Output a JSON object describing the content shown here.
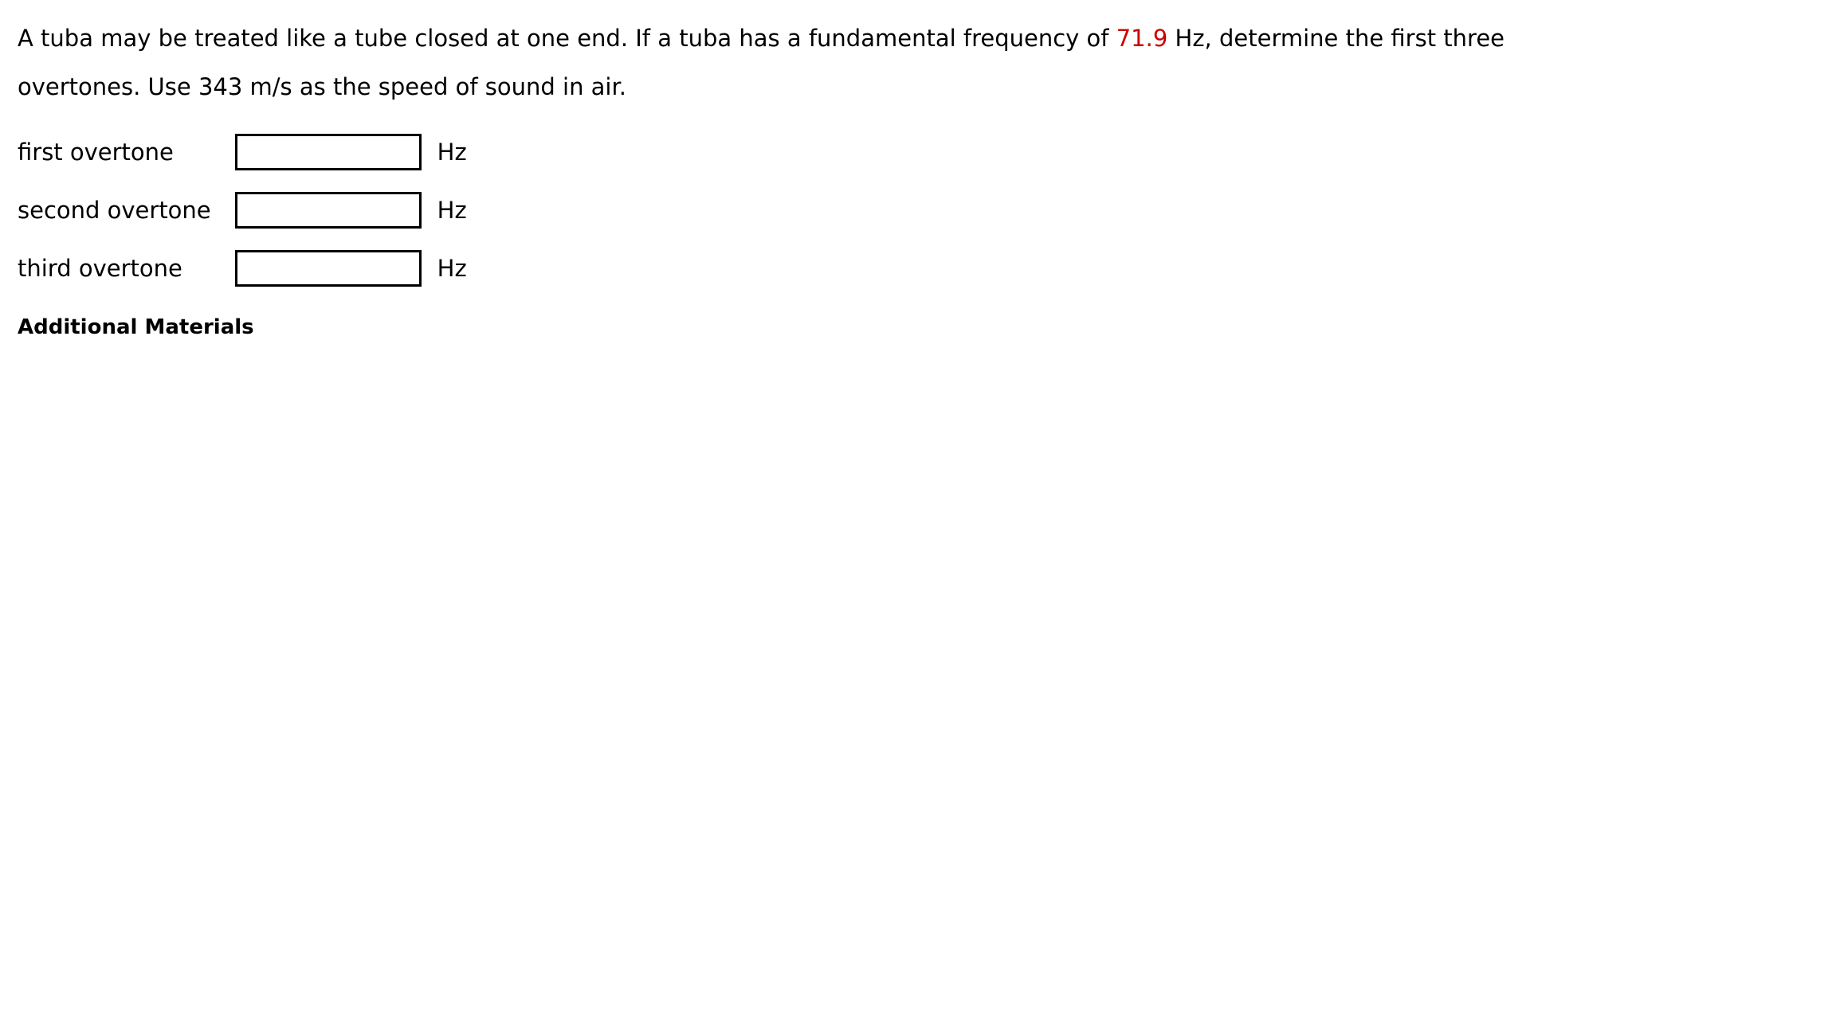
{
  "question": {
    "text_before_value": "A tuba may be treated like a tube closed at one end. If a tuba has a fundamental frequency of",
    "highlighted_value": "71.9",
    "text_after_value": "Hz, determine the first three overtones. Use 343 m/s as the speed of sound in air.",
    "highlight_color": "#cc0000"
  },
  "answers": {
    "rows": [
      {
        "label": "first overtone",
        "value": "",
        "unit": "Hz"
      },
      {
        "label": "second overtone",
        "value": "",
        "unit": "Hz"
      },
      {
        "label": "third overtone",
        "value": "",
        "unit": "Hz"
      }
    ]
  },
  "footer": {
    "additional_materials_label": "Additional Materials"
  }
}
